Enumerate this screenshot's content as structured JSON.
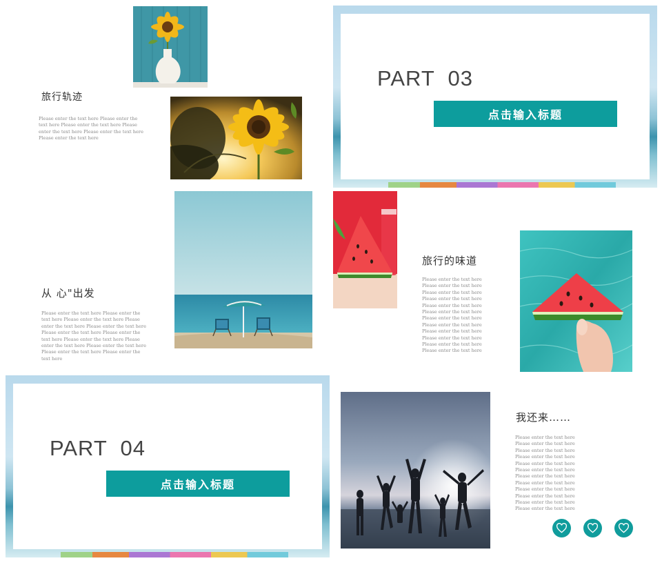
{
  "slide1": {
    "title": "旅行轨迹",
    "body": "Please enter the text here Please enter the text here Please enter the text here Please enter the text here Please enter the text here Please enter the text here"
  },
  "slide2": {
    "part_label": "PART  03",
    "button_label": "点击输入标题"
  },
  "slide3": {
    "title": "从 心\"出发",
    "body": "Please enter the text here Please enter the text here Please enter the text here Please enter the text here Please enter the text here Please enter the text here Please enter the text here Please enter the text here Please enter the text here Please enter the text here Please enter the text here Please enter the text here"
  },
  "slide4": {
    "title": "旅行的味道",
    "body": "Please enter the text here Please enter the text here Please enter the text here Please enter the text here Please enter the text here Please enter the text here Please enter the text here Please enter the text here Please enter the text here Please enter the text here Please enter the text here Please enter the text here"
  },
  "slide5": {
    "part_label": "PART  04",
    "button_label": "点击输入标题"
  },
  "slide6": {
    "title": "我还来……",
    "body": "Please enter the text here Please enter the text here Please enter the text here Please enter the text here Please enter the text here Please enter the text here Please enter the text here Please enter the text here Please enter the text here Please enter the text here Please enter the text here Please enter the text here",
    "icons": [
      "heart-icon",
      "heart-icon",
      "heart-icon"
    ],
    "accent": "#109c9c"
  }
}
